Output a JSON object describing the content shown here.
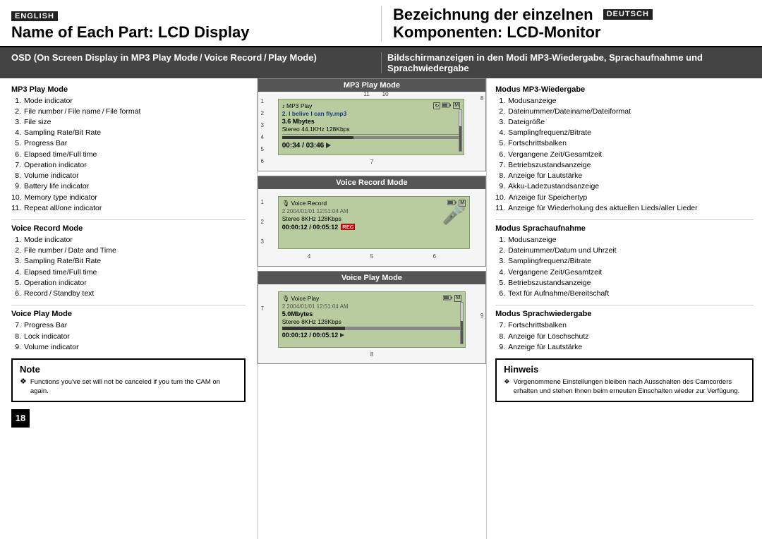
{
  "header": {
    "english_badge": "ENGLISH",
    "deutsch_badge": "DEUTSCH",
    "left_title": "Name of Each Part: LCD Display",
    "right_title_line1": "Bezeichnung der einzelnen",
    "right_title_line2": "Komponenten: LCD-Monitor"
  },
  "osd_banner": {
    "left": "OSD (On Screen Display in MP3 Play Mode / Voice Record / Play Mode)",
    "right": "Bildschirmanzeigen in den Modi MP3-Wiedergabe, Sprachaufnahme und Sprachwiedergabe"
  },
  "mp3_play_mode": {
    "title": "MP3 Play Mode",
    "items": [
      {
        "num": "1.",
        "text": "Mode indicator"
      },
      {
        "num": "2.",
        "text": "File number / File name / File format"
      },
      {
        "num": "3.",
        "text": "File size"
      },
      {
        "num": "4.",
        "text": "Sampling Rate/Bit Rate"
      },
      {
        "num": "5.",
        "text": "Progress Bar"
      },
      {
        "num": "6.",
        "text": "Elapsed time/Full time"
      },
      {
        "num": "7.",
        "text": "Operation indicator"
      },
      {
        "num": "8.",
        "text": "Volume indicator"
      },
      {
        "num": "9.",
        "text": "Battery life indicator"
      },
      {
        "num": "10.",
        "text": "Memory type indicator"
      },
      {
        "num": "11.",
        "text": "Repeat all/one indicator"
      }
    ]
  },
  "voice_record_mode": {
    "title": "Voice Record Mode",
    "items": [
      {
        "num": "1.",
        "text": "Mode indicator"
      },
      {
        "num": "2.",
        "text": "File number / Date and Time"
      },
      {
        "num": "3.",
        "text": "Sampling Rate/Bit Rate"
      },
      {
        "num": "4.",
        "text": "Elapsed time/Full time"
      },
      {
        "num": "5.",
        "text": "Operation indicator"
      },
      {
        "num": "6.",
        "text": "Record / Standby text"
      }
    ]
  },
  "voice_play_mode": {
    "title": "Voice Play Mode",
    "items": [
      {
        "num": "7.",
        "text": "Progress Bar"
      },
      {
        "num": "8.",
        "text": "Lock indicator"
      },
      {
        "num": "9.",
        "text": "Volume indicator"
      }
    ]
  },
  "lcd_mp3": {
    "header": "MP3 Play Mode",
    "mode_label": "MP3 Play",
    "track": "2.  I belive I can fly.mp3",
    "filesize": "3.6 Mbytes",
    "quality": "Stereo 44.1KHz 128Kbps",
    "time": "00:34 / 03:46",
    "callout_top_left": "11",
    "callout_top_right": "10",
    "callout_right": "8",
    "callout_nums_left": [
      "1",
      "2",
      "3",
      "4",
      "5",
      "6"
    ],
    "callout_bottom": [
      "7"
    ]
  },
  "lcd_voice_record": {
    "header": "Voice Record Mode",
    "mode_label": "Voice Record",
    "track": "2  2004/01/01  12:51:04 AM",
    "quality": "Stereo 8KHz 128Kbps",
    "time": "00:00:12 / 00:05:12",
    "callout_nums_left": [
      "1",
      "2",
      "3"
    ],
    "callout_nums_bottom": [
      "4",
      "5",
      "6"
    ]
  },
  "lcd_voice_play": {
    "header": "Voice Play Mode",
    "mode_label": "Voice Play",
    "track": "2  2004/01/01  12:51:04 AM",
    "filesize": "5.0Mbytes",
    "quality": "Stereo 8KHz 128Kbps",
    "time": "00:00:12 / 00:05:12",
    "callout_nums_left": [
      "7"
    ],
    "callout_right": "9",
    "callout_bottom": [
      "8"
    ]
  },
  "note": {
    "title": "Note",
    "diamond": "❖",
    "text": "Functions you've set will not be canceled if you turn the CAM on again."
  },
  "hinweis": {
    "title": "Hinweis",
    "diamond": "❖",
    "text": "Vorgenommene Einstellungen bleiben nach Ausschalten des Camcorders erhalten und stehen Ihnen beim erneuten Einschalten wieder zur Verfügung."
  },
  "deutsch_mp3": {
    "title": "Modus MP3-Wiedergabe",
    "items": [
      {
        "num": "1.",
        "text": "Modusanzeige"
      },
      {
        "num": "2.",
        "text": "Dateinummer/Dateiname/Dateiformat"
      },
      {
        "num": "3.",
        "text": "Dateigröße"
      },
      {
        "num": "4.",
        "text": "Samplingfrequenz/Bitrate"
      },
      {
        "num": "5.",
        "text": "Fortschrittsbalken"
      },
      {
        "num": "6.",
        "text": "Vergangene Zeit/Gesamtzeit"
      },
      {
        "num": "7.",
        "text": "Betriebszustandsanzeige"
      },
      {
        "num": "8.",
        "text": "Anzeige für Lautstärke"
      },
      {
        "num": "9.",
        "text": "Akku-Ladezustandsanzeige"
      },
      {
        "num": "10.",
        "text": "Anzeige für Speichertyp"
      },
      {
        "num": "11.",
        "text": "Anzeige für Wiederholung des aktuellen Lieds/aller Lieder"
      }
    ]
  },
  "deutsch_voice_record": {
    "title": "Modus Sprachaufnahme",
    "items": [
      {
        "num": "1.",
        "text": "Modusanzeige"
      },
      {
        "num": "2.",
        "text": "Dateinummer/Datum und Uhrzeit"
      },
      {
        "num": "3.",
        "text": "Samplingfrequenz/Bitrate"
      },
      {
        "num": "4.",
        "text": "Vergangene Zeit/Gesamtzeit"
      },
      {
        "num": "5.",
        "text": "Betriebszustandsanzeige"
      },
      {
        "num": "6.",
        "text": "Text für Aufnahme/Bereitschaft"
      }
    ]
  },
  "deutsch_voice_play": {
    "title": "Modus Sprachwiedergabe",
    "items": [
      {
        "num": "7.",
        "text": "Fortschrittsbalken"
      },
      {
        "num": "8.",
        "text": "Anzeige für Löschschutz"
      },
      {
        "num": "9.",
        "text": "Anzeige für Lautstärke"
      }
    ]
  },
  "page_number": "18"
}
